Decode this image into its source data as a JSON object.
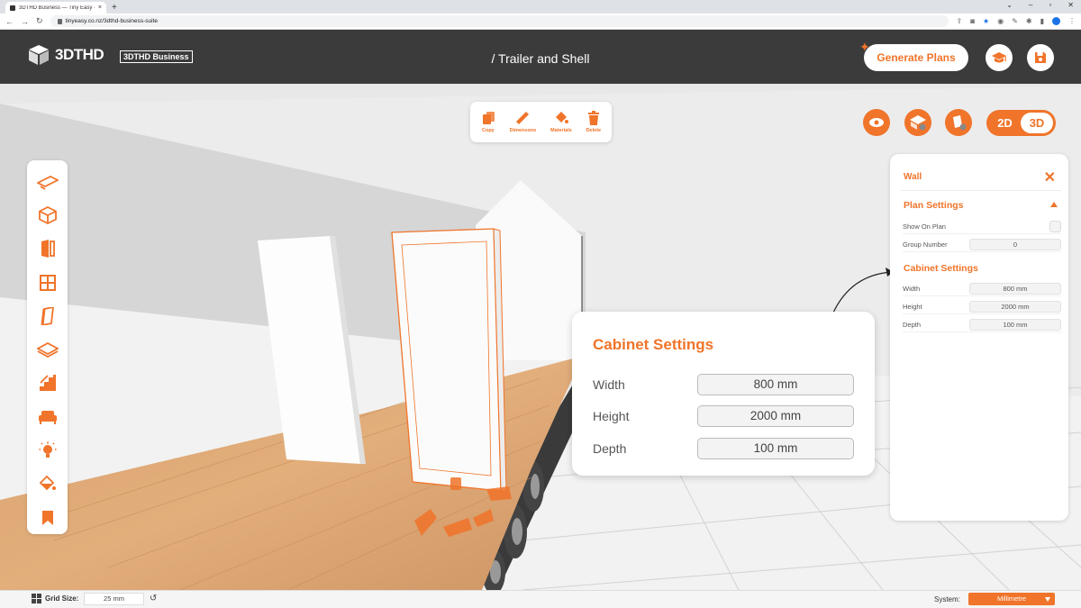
{
  "browser": {
    "tab_title": "3DTHD Business — Tiny Easy - Ti",
    "tab_close": "×",
    "new_tab": "+",
    "url": "tinyeasy.co.nz/3dthd-business-suite",
    "window_controls": [
      "⌄",
      "–",
      "▫",
      "✕"
    ]
  },
  "header": {
    "logo_text": "3DTHD",
    "badge": "3DTHD Business",
    "title": "/ Trailer and Shell",
    "generate_label": "Generate Plans",
    "icons": [
      "graduation-cap-icon",
      "save-icon"
    ]
  },
  "toolbar": {
    "items": [
      {
        "label": "Copy",
        "icon": "copy-icon"
      },
      {
        "label": "Dimensons",
        "icon": "ruler-icon"
      },
      {
        "label": "Materials",
        "icon": "paint-bucket-icon"
      },
      {
        "label": "Delete",
        "icon": "trash-icon"
      }
    ]
  },
  "view": {
    "toggle_2d": "2D",
    "toggle_3d": "3D",
    "active": "3D"
  },
  "sidebar": {
    "items": [
      "trailer-icon",
      "cube-icon",
      "door-icon",
      "window-icon",
      "wall-panel-icon",
      "floor-icon",
      "stairs-icon",
      "sofa-icon",
      "lightbulb-icon",
      "paint-bucket-icon",
      "bookmark-icon"
    ]
  },
  "panel": {
    "title": "Wall",
    "plan_settings": "Plan Settings",
    "show_on_plan_label": "Show On Plan",
    "group_number_label": "Group Number",
    "group_number_value": "0",
    "cabinet_settings": "Cabinet Settings",
    "width_label": "Width",
    "width_value": "800 mm",
    "height_label": "Height",
    "height_value": "2000 mm",
    "depth_label": "Depth",
    "depth_value": "100 mm"
  },
  "callout": {
    "title": "Cabinet Settings",
    "width_label": "Width",
    "width_value": "800 mm",
    "height_label": "Height",
    "height_value": "2000 mm",
    "depth_label": "Depth",
    "depth_value": "100 mm"
  },
  "status": {
    "grid_label": "Grid Size:",
    "grid_value": "25 mm",
    "system_label": "System:",
    "system_value": "Millimetre"
  },
  "colors": {
    "accent": "#f0742a",
    "header_bg": "#3b3b3b"
  }
}
